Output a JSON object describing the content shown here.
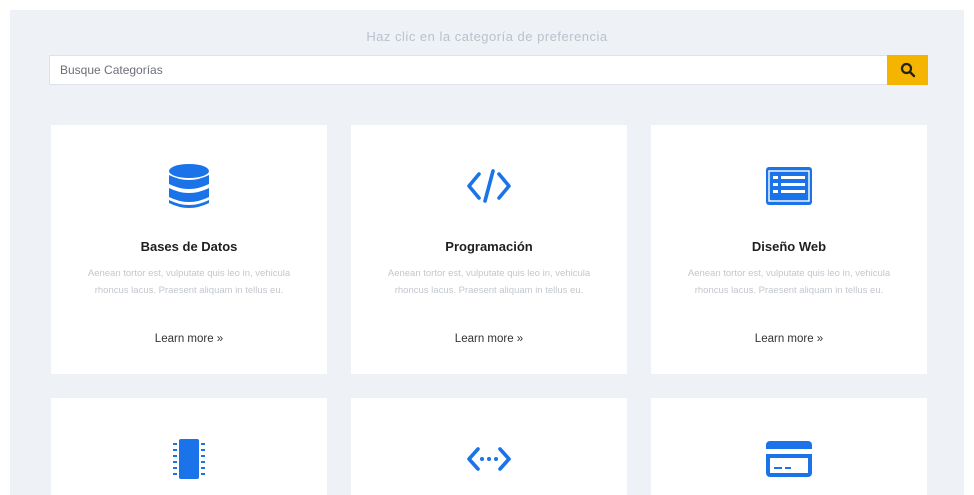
{
  "header": {
    "hint": "Haz clic en la categoría de preferencia"
  },
  "search": {
    "placeholder": "Busque Categorías",
    "button_icon": "search-icon"
  },
  "colors": {
    "accent": "#f4b400",
    "icon_blue": "#1a73e8",
    "page_bg": "#eef2f7"
  },
  "cards": [
    {
      "title": "Bases de Datos",
      "icon": "database-icon",
      "description": "Aenean tortor est, vulputate quis leo in, vehicula rhoncus lacus. Praesent aliquam in tellus eu.",
      "link": "Learn more »"
    },
    {
      "title": "Programación",
      "icon": "code-icon",
      "description": "Aenean tortor est, vulputate quis leo in, vehicula rhoncus lacus. Praesent aliquam in tellus eu.",
      "link": "Learn more »"
    },
    {
      "title": "Diseño Web",
      "icon": "web-list-icon",
      "description": "Aenean tortor est, vulputate quis leo in, vehicula rhoncus lacus. Praesent aliquam in tellus eu.",
      "link": "Learn more »"
    },
    {
      "icon": "chip-icon"
    },
    {
      "icon": "api-icon"
    },
    {
      "icon": "credit-card-icon"
    }
  ]
}
